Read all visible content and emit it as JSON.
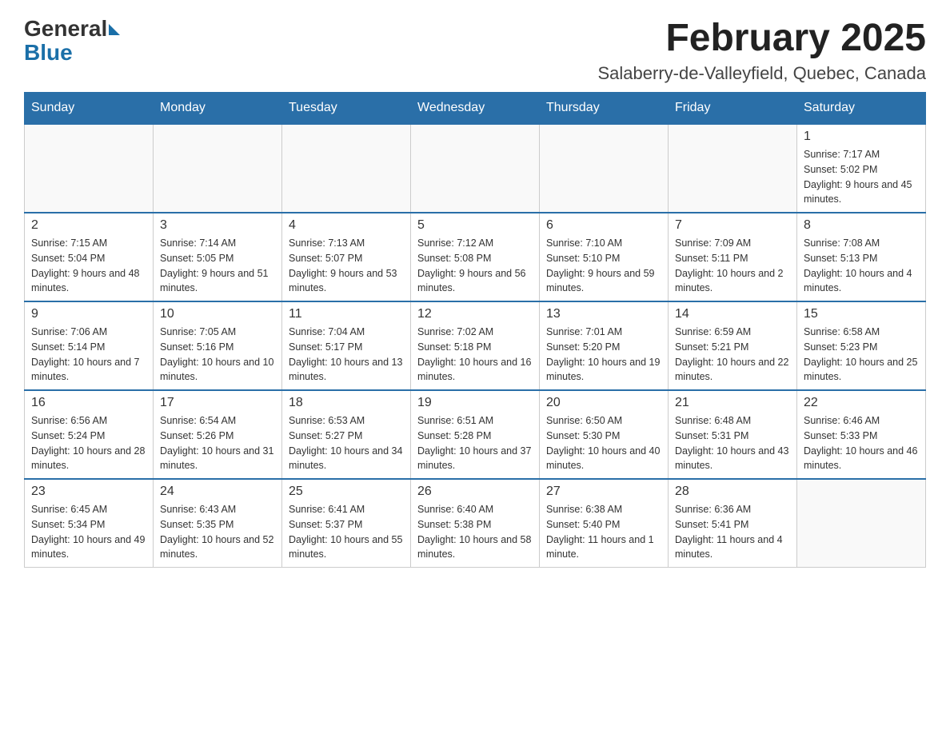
{
  "header": {
    "logo": {
      "general": "General",
      "blue": "Blue"
    },
    "month": "February 2025",
    "location": "Salaberry-de-Valleyfield, Quebec, Canada"
  },
  "weekdays": [
    "Sunday",
    "Monday",
    "Tuesday",
    "Wednesday",
    "Thursday",
    "Friday",
    "Saturday"
  ],
  "weeks": [
    [
      {
        "day": "",
        "info": ""
      },
      {
        "day": "",
        "info": ""
      },
      {
        "day": "",
        "info": ""
      },
      {
        "day": "",
        "info": ""
      },
      {
        "day": "",
        "info": ""
      },
      {
        "day": "",
        "info": ""
      },
      {
        "day": "1",
        "info": "Sunrise: 7:17 AM\nSunset: 5:02 PM\nDaylight: 9 hours and 45 minutes."
      }
    ],
    [
      {
        "day": "2",
        "info": "Sunrise: 7:15 AM\nSunset: 5:04 PM\nDaylight: 9 hours and 48 minutes."
      },
      {
        "day": "3",
        "info": "Sunrise: 7:14 AM\nSunset: 5:05 PM\nDaylight: 9 hours and 51 minutes."
      },
      {
        "day": "4",
        "info": "Sunrise: 7:13 AM\nSunset: 5:07 PM\nDaylight: 9 hours and 53 minutes."
      },
      {
        "day": "5",
        "info": "Sunrise: 7:12 AM\nSunset: 5:08 PM\nDaylight: 9 hours and 56 minutes."
      },
      {
        "day": "6",
        "info": "Sunrise: 7:10 AM\nSunset: 5:10 PM\nDaylight: 9 hours and 59 minutes."
      },
      {
        "day": "7",
        "info": "Sunrise: 7:09 AM\nSunset: 5:11 PM\nDaylight: 10 hours and 2 minutes."
      },
      {
        "day": "8",
        "info": "Sunrise: 7:08 AM\nSunset: 5:13 PM\nDaylight: 10 hours and 4 minutes."
      }
    ],
    [
      {
        "day": "9",
        "info": "Sunrise: 7:06 AM\nSunset: 5:14 PM\nDaylight: 10 hours and 7 minutes."
      },
      {
        "day": "10",
        "info": "Sunrise: 7:05 AM\nSunset: 5:16 PM\nDaylight: 10 hours and 10 minutes."
      },
      {
        "day": "11",
        "info": "Sunrise: 7:04 AM\nSunset: 5:17 PM\nDaylight: 10 hours and 13 minutes."
      },
      {
        "day": "12",
        "info": "Sunrise: 7:02 AM\nSunset: 5:18 PM\nDaylight: 10 hours and 16 minutes."
      },
      {
        "day": "13",
        "info": "Sunrise: 7:01 AM\nSunset: 5:20 PM\nDaylight: 10 hours and 19 minutes."
      },
      {
        "day": "14",
        "info": "Sunrise: 6:59 AM\nSunset: 5:21 PM\nDaylight: 10 hours and 22 minutes."
      },
      {
        "day": "15",
        "info": "Sunrise: 6:58 AM\nSunset: 5:23 PM\nDaylight: 10 hours and 25 minutes."
      }
    ],
    [
      {
        "day": "16",
        "info": "Sunrise: 6:56 AM\nSunset: 5:24 PM\nDaylight: 10 hours and 28 minutes."
      },
      {
        "day": "17",
        "info": "Sunrise: 6:54 AM\nSunset: 5:26 PM\nDaylight: 10 hours and 31 minutes."
      },
      {
        "day": "18",
        "info": "Sunrise: 6:53 AM\nSunset: 5:27 PM\nDaylight: 10 hours and 34 minutes."
      },
      {
        "day": "19",
        "info": "Sunrise: 6:51 AM\nSunset: 5:28 PM\nDaylight: 10 hours and 37 minutes."
      },
      {
        "day": "20",
        "info": "Sunrise: 6:50 AM\nSunset: 5:30 PM\nDaylight: 10 hours and 40 minutes."
      },
      {
        "day": "21",
        "info": "Sunrise: 6:48 AM\nSunset: 5:31 PM\nDaylight: 10 hours and 43 minutes."
      },
      {
        "day": "22",
        "info": "Sunrise: 6:46 AM\nSunset: 5:33 PM\nDaylight: 10 hours and 46 minutes."
      }
    ],
    [
      {
        "day": "23",
        "info": "Sunrise: 6:45 AM\nSunset: 5:34 PM\nDaylight: 10 hours and 49 minutes."
      },
      {
        "day": "24",
        "info": "Sunrise: 6:43 AM\nSunset: 5:35 PM\nDaylight: 10 hours and 52 minutes."
      },
      {
        "day": "25",
        "info": "Sunrise: 6:41 AM\nSunset: 5:37 PM\nDaylight: 10 hours and 55 minutes."
      },
      {
        "day": "26",
        "info": "Sunrise: 6:40 AM\nSunset: 5:38 PM\nDaylight: 10 hours and 58 minutes."
      },
      {
        "day": "27",
        "info": "Sunrise: 6:38 AM\nSunset: 5:40 PM\nDaylight: 11 hours and 1 minute."
      },
      {
        "day": "28",
        "info": "Sunrise: 6:36 AM\nSunset: 5:41 PM\nDaylight: 11 hours and 4 minutes."
      },
      {
        "day": "",
        "info": ""
      }
    ]
  ]
}
